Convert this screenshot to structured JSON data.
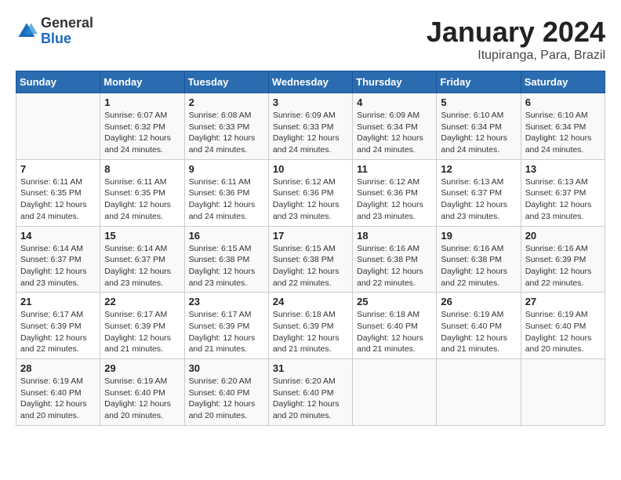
{
  "header": {
    "logo_general": "General",
    "logo_blue": "Blue",
    "title": "January 2024",
    "subtitle": "Itupiranga, Para, Brazil"
  },
  "calendar": {
    "days_of_week": [
      "Sunday",
      "Monday",
      "Tuesday",
      "Wednesday",
      "Thursday",
      "Friday",
      "Saturday"
    ],
    "weeks": [
      [
        {
          "day": "",
          "sunrise": "",
          "sunset": "",
          "daylight": ""
        },
        {
          "day": "1",
          "sunrise": "Sunrise: 6:07 AM",
          "sunset": "Sunset: 6:32 PM",
          "daylight": "Daylight: 12 hours and 24 minutes."
        },
        {
          "day": "2",
          "sunrise": "Sunrise: 6:08 AM",
          "sunset": "Sunset: 6:33 PM",
          "daylight": "Daylight: 12 hours and 24 minutes."
        },
        {
          "day": "3",
          "sunrise": "Sunrise: 6:09 AM",
          "sunset": "Sunset: 6:33 PM",
          "daylight": "Daylight: 12 hours and 24 minutes."
        },
        {
          "day": "4",
          "sunrise": "Sunrise: 6:09 AM",
          "sunset": "Sunset: 6:34 PM",
          "daylight": "Daylight: 12 hours and 24 minutes."
        },
        {
          "day": "5",
          "sunrise": "Sunrise: 6:10 AM",
          "sunset": "Sunset: 6:34 PM",
          "daylight": "Daylight: 12 hours and 24 minutes."
        },
        {
          "day": "6",
          "sunrise": "Sunrise: 6:10 AM",
          "sunset": "Sunset: 6:34 PM",
          "daylight": "Daylight: 12 hours and 24 minutes."
        }
      ],
      [
        {
          "day": "7",
          "sunrise": "Sunrise: 6:11 AM",
          "sunset": "Sunset: 6:35 PM",
          "daylight": "Daylight: 12 hours and 24 minutes."
        },
        {
          "day": "8",
          "sunrise": "Sunrise: 6:11 AM",
          "sunset": "Sunset: 6:35 PM",
          "daylight": "Daylight: 12 hours and 24 minutes."
        },
        {
          "day": "9",
          "sunrise": "Sunrise: 6:11 AM",
          "sunset": "Sunset: 6:36 PM",
          "daylight": "Daylight: 12 hours and 24 minutes."
        },
        {
          "day": "10",
          "sunrise": "Sunrise: 6:12 AM",
          "sunset": "Sunset: 6:36 PM",
          "daylight": "Daylight: 12 hours and 23 minutes."
        },
        {
          "day": "11",
          "sunrise": "Sunrise: 6:12 AM",
          "sunset": "Sunset: 6:36 PM",
          "daylight": "Daylight: 12 hours and 23 minutes."
        },
        {
          "day": "12",
          "sunrise": "Sunrise: 6:13 AM",
          "sunset": "Sunset: 6:37 PM",
          "daylight": "Daylight: 12 hours and 23 minutes."
        },
        {
          "day": "13",
          "sunrise": "Sunrise: 6:13 AM",
          "sunset": "Sunset: 6:37 PM",
          "daylight": "Daylight: 12 hours and 23 minutes."
        }
      ],
      [
        {
          "day": "14",
          "sunrise": "Sunrise: 6:14 AM",
          "sunset": "Sunset: 6:37 PM",
          "daylight": "Daylight: 12 hours and 23 minutes."
        },
        {
          "day": "15",
          "sunrise": "Sunrise: 6:14 AM",
          "sunset": "Sunset: 6:37 PM",
          "daylight": "Daylight: 12 hours and 23 minutes."
        },
        {
          "day": "16",
          "sunrise": "Sunrise: 6:15 AM",
          "sunset": "Sunset: 6:38 PM",
          "daylight": "Daylight: 12 hours and 23 minutes."
        },
        {
          "day": "17",
          "sunrise": "Sunrise: 6:15 AM",
          "sunset": "Sunset: 6:38 PM",
          "daylight": "Daylight: 12 hours and 22 minutes."
        },
        {
          "day": "18",
          "sunrise": "Sunrise: 6:16 AM",
          "sunset": "Sunset: 6:38 PM",
          "daylight": "Daylight: 12 hours and 22 minutes."
        },
        {
          "day": "19",
          "sunrise": "Sunrise: 6:16 AM",
          "sunset": "Sunset: 6:38 PM",
          "daylight": "Daylight: 12 hours and 22 minutes."
        },
        {
          "day": "20",
          "sunrise": "Sunrise: 6:16 AM",
          "sunset": "Sunset: 6:39 PM",
          "daylight": "Daylight: 12 hours and 22 minutes."
        }
      ],
      [
        {
          "day": "21",
          "sunrise": "Sunrise: 6:17 AM",
          "sunset": "Sunset: 6:39 PM",
          "daylight": "Daylight: 12 hours and 22 minutes."
        },
        {
          "day": "22",
          "sunrise": "Sunrise: 6:17 AM",
          "sunset": "Sunset: 6:39 PM",
          "daylight": "Daylight: 12 hours and 21 minutes."
        },
        {
          "day": "23",
          "sunrise": "Sunrise: 6:17 AM",
          "sunset": "Sunset: 6:39 PM",
          "daylight": "Daylight: 12 hours and 21 minutes."
        },
        {
          "day": "24",
          "sunrise": "Sunrise: 6:18 AM",
          "sunset": "Sunset: 6:39 PM",
          "daylight": "Daylight: 12 hours and 21 minutes."
        },
        {
          "day": "25",
          "sunrise": "Sunrise: 6:18 AM",
          "sunset": "Sunset: 6:40 PM",
          "daylight": "Daylight: 12 hours and 21 minutes."
        },
        {
          "day": "26",
          "sunrise": "Sunrise: 6:19 AM",
          "sunset": "Sunset: 6:40 PM",
          "daylight": "Daylight: 12 hours and 21 minutes."
        },
        {
          "day": "27",
          "sunrise": "Sunrise: 6:19 AM",
          "sunset": "Sunset: 6:40 PM",
          "daylight": "Daylight: 12 hours and 20 minutes."
        }
      ],
      [
        {
          "day": "28",
          "sunrise": "Sunrise: 6:19 AM",
          "sunset": "Sunset: 6:40 PM",
          "daylight": "Daylight: 12 hours and 20 minutes."
        },
        {
          "day": "29",
          "sunrise": "Sunrise: 6:19 AM",
          "sunset": "Sunset: 6:40 PM",
          "daylight": "Daylight: 12 hours and 20 minutes."
        },
        {
          "day": "30",
          "sunrise": "Sunrise: 6:20 AM",
          "sunset": "Sunset: 6:40 PM",
          "daylight": "Daylight: 12 hours and 20 minutes."
        },
        {
          "day": "31",
          "sunrise": "Sunrise: 6:20 AM",
          "sunset": "Sunset: 6:40 PM",
          "daylight": "Daylight: 12 hours and 20 minutes."
        },
        {
          "day": "",
          "sunrise": "",
          "sunset": "",
          "daylight": ""
        },
        {
          "day": "",
          "sunrise": "",
          "sunset": "",
          "daylight": ""
        },
        {
          "day": "",
          "sunrise": "",
          "sunset": "",
          "daylight": ""
        }
      ]
    ]
  }
}
